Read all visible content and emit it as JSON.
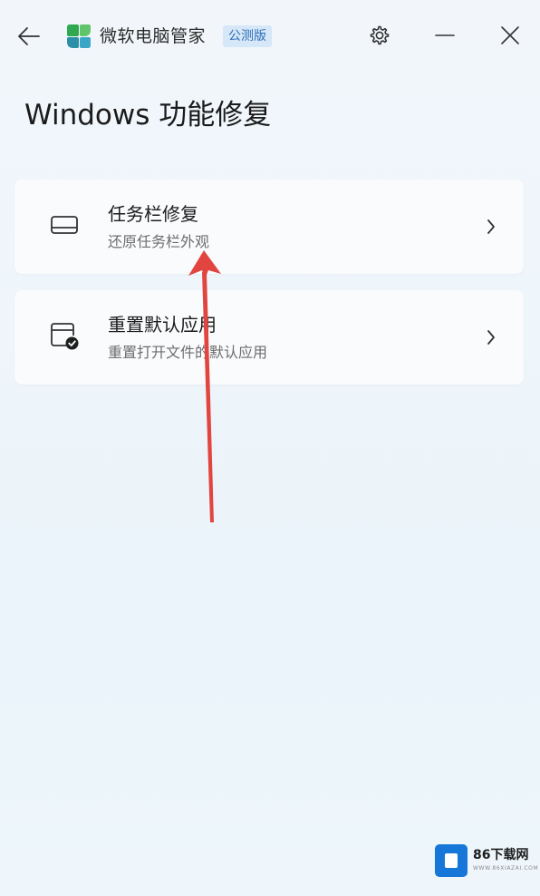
{
  "titlebar": {
    "app_title": "微软电脑管家",
    "badge": "公测版",
    "icons": {
      "back": "back-arrow-icon",
      "logo": "app-logo-icon",
      "settings": "gear-icon",
      "minimize": "minimize-icon",
      "close": "close-icon"
    }
  },
  "page": {
    "title": "Windows 功能修复"
  },
  "items": [
    {
      "title": "任务栏修复",
      "subtitle": "还原任务栏外观",
      "icon": "taskbar-icon"
    },
    {
      "title": "重置默认应用",
      "subtitle": "重置打开文件的默认应用",
      "icon": "default-app-icon"
    }
  ],
  "annotation": {
    "color": "#e2453f"
  },
  "watermark": {
    "text": "86下载网",
    "sub": "WWW.86XIAZAI.COM"
  },
  "colors": {
    "accent": "#2e6fb8",
    "badge_bg": "#d6e7f7",
    "logo_green": "#2fa84f",
    "logo_teal": "#2b8fa6"
  }
}
